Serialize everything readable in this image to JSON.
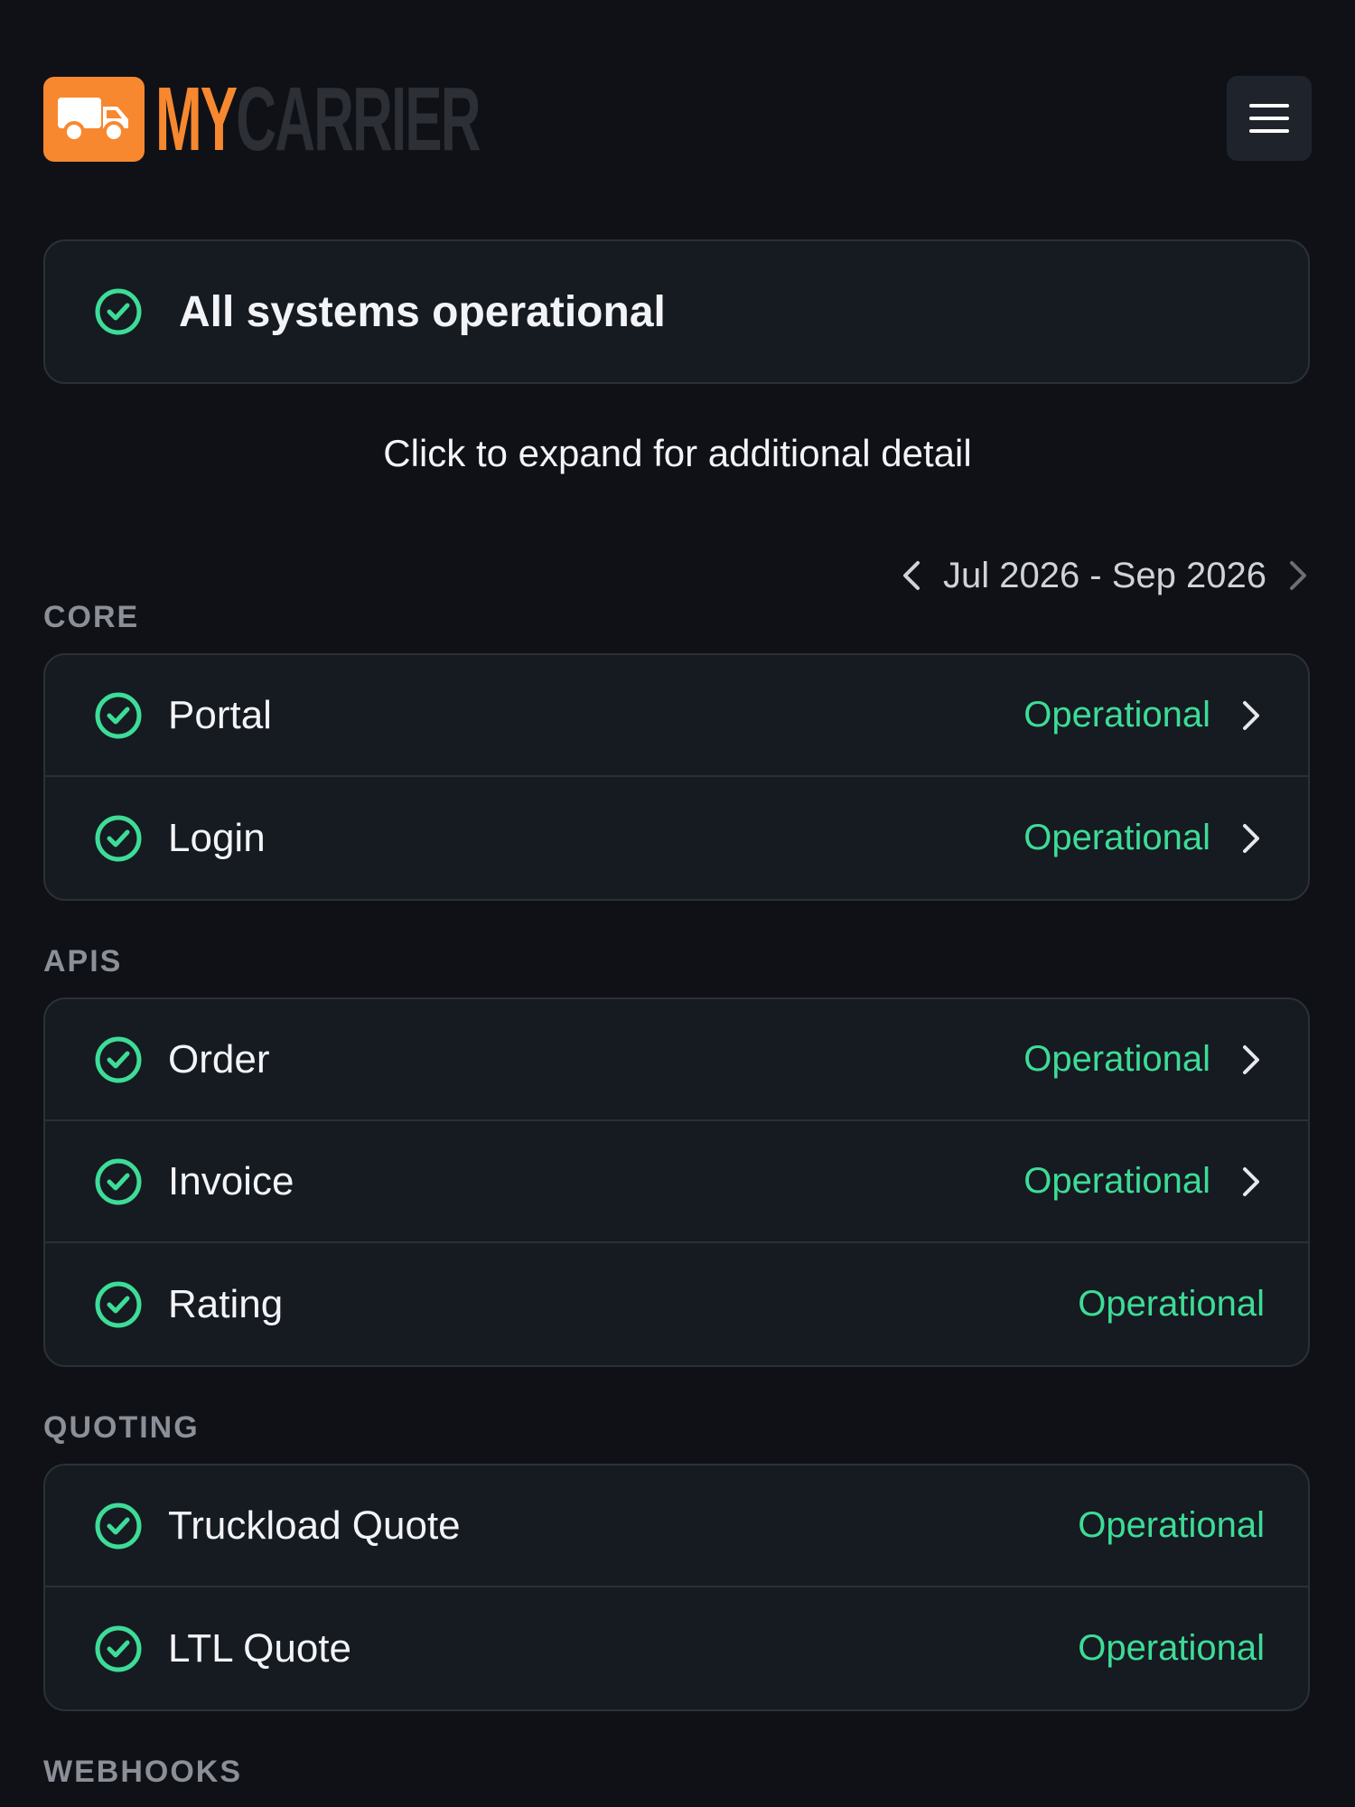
{
  "brand": {
    "logo_my": "MY",
    "logo_carrier": "CARRIER",
    "accent": "#f7882f"
  },
  "menu": {
    "icon": "hamburger-menu-icon"
  },
  "summary": {
    "text": "All systems operational",
    "icon": "check-circle-icon",
    "status_color": "#3ddc97"
  },
  "hint": "Click to expand for additional detail",
  "date_range": {
    "label": "Jul 2026 - Sep 2026",
    "prev_icon": "chevron-left-icon",
    "next_icon": "chevron-right-icon"
  },
  "sections": [
    {
      "label": "CORE",
      "items": [
        {
          "name": "Portal",
          "status": "Operational",
          "expandable": true
        },
        {
          "name": "Login",
          "status": "Operational",
          "expandable": true
        }
      ]
    },
    {
      "label": "APIS",
      "items": [
        {
          "name": "Order",
          "status": "Operational",
          "expandable": true
        },
        {
          "name": "Invoice",
          "status": "Operational",
          "expandable": true
        },
        {
          "name": "Rating",
          "status": "Operational",
          "expandable": false
        }
      ]
    },
    {
      "label": "QUOTING",
      "items": [
        {
          "name": "Truckload Quote",
          "status": "Operational",
          "expandable": false
        },
        {
          "name": "LTL Quote",
          "status": "Operational",
          "expandable": false
        }
      ]
    },
    {
      "label": "WEBHOOKS",
      "items": []
    }
  ]
}
